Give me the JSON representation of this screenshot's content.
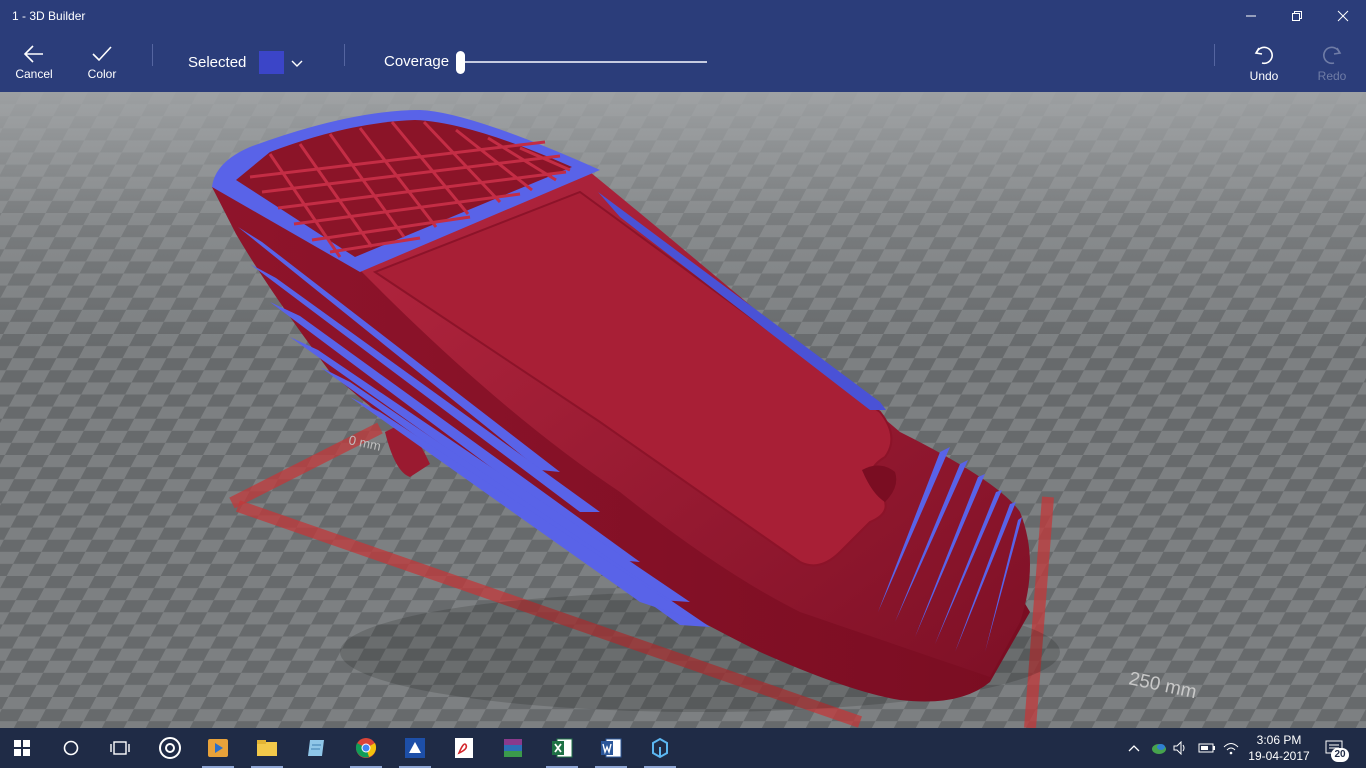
{
  "window": {
    "title": "1 - 3D Builder"
  },
  "toolbar": {
    "cancel_label": "Cancel",
    "color_label": "Color",
    "selected_label": "Selected",
    "selected_color": "#3b45c8",
    "coverage_label": "Coverage",
    "coverage_value": 0,
    "undo_label": "Undo",
    "redo_label": "Redo"
  },
  "viewport": {
    "scale_label_left": "0 mm",
    "scale_label_right": "250 mm",
    "model_color_primary": "#a51f35",
    "model_color_selected": "#5963e8"
  },
  "taskbar": {
    "apps": [
      {
        "name": "start-icon"
      },
      {
        "name": "cortana-icon"
      },
      {
        "name": "task-view-icon"
      },
      {
        "name": "groove-icon"
      },
      {
        "name": "media-player-icon"
      },
      {
        "name": "file-explorer-icon"
      },
      {
        "name": "notepad-icon"
      },
      {
        "name": "chrome-icon"
      },
      {
        "name": "app-icon"
      },
      {
        "name": "pdf-icon"
      },
      {
        "name": "winrar-icon"
      },
      {
        "name": "excel-icon"
      },
      {
        "name": "word-icon"
      },
      {
        "name": "3d-builder-icon"
      }
    ],
    "time": "3:06 PM",
    "date": "19-04-2017",
    "notification_count": "20"
  }
}
